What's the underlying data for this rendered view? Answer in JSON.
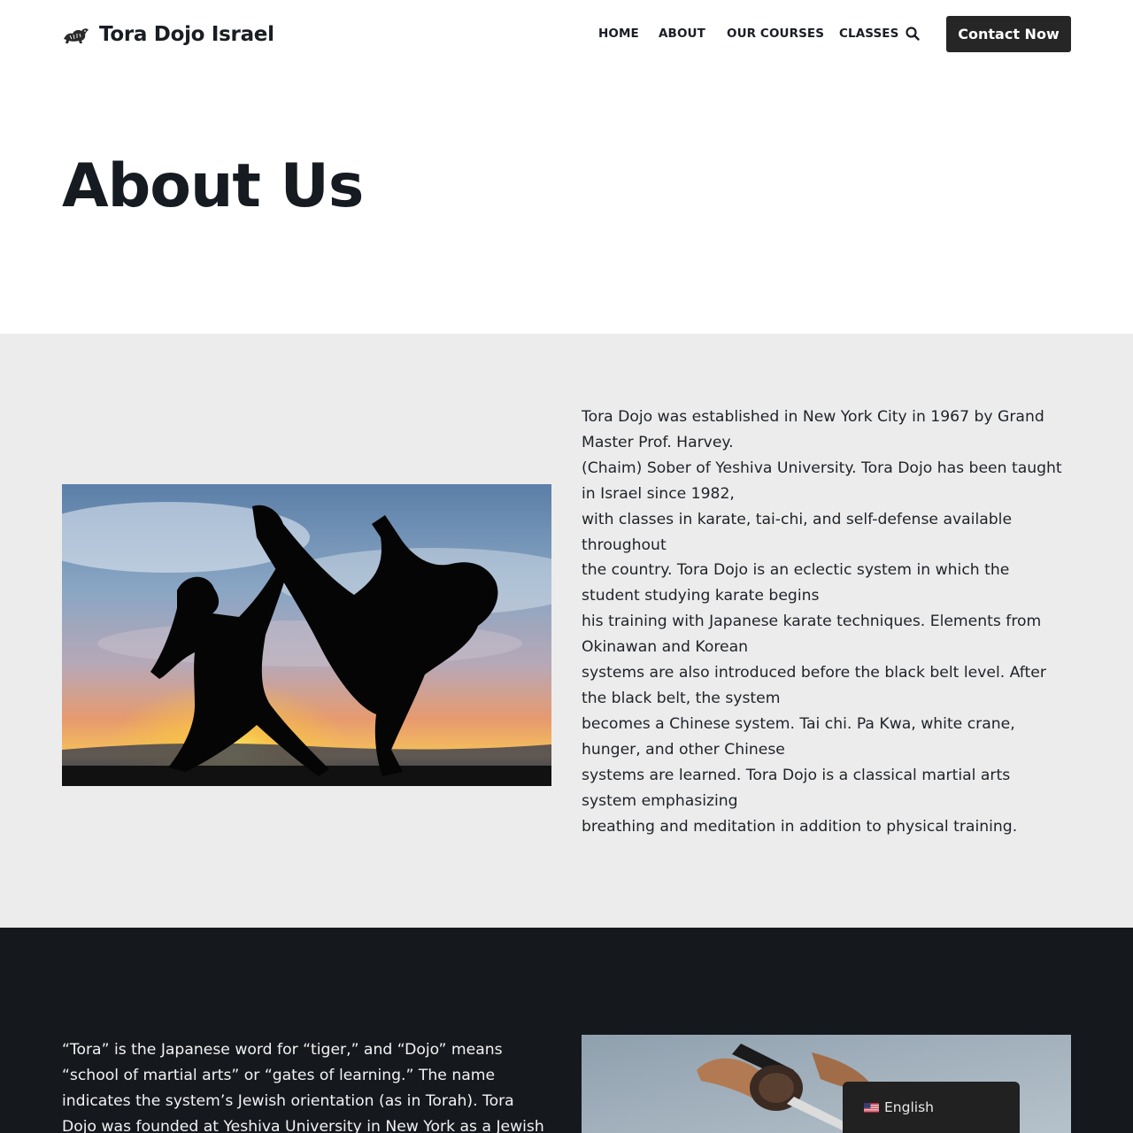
{
  "header": {
    "brand": "Tora Dojo Israel",
    "logo_icon": "tiger-logo-icon",
    "nav": [
      "HOME",
      "ABOUT",
      "OUR COURSES",
      "CLASSES"
    ],
    "search_icon": "search-icon",
    "cta": "Contact Now"
  },
  "title": "About Us",
  "about": {
    "image": "karate-fighters-silhouette-sunset",
    "lines": [
      "Tora Dojo was established in New York City in 1967 by Grand",
      "Master Prof. Harvey.",
      "(Chaim) Sober of Yeshiva University. Tora Dojo has been taught",
      "in Israel since 1982,",
      "with classes in karate, tai-chi, and self-defense available",
      "throughout",
      "the country. Tora Dojo is an eclectic system in which the",
      "student studying karate begins",
      "his training with Japanese karate techniques. Elements from",
      "Okinawan and Korean",
      "systems are also introduced before the black belt level. After",
      "the black belt, the system",
      "becomes a Chinese system. Tai chi. Pa Kwa, white crane,",
      "hunger, and other Chinese",
      "systems are learned. Tora Dojo is a classical martial arts",
      "system emphasizing",
      "breathing and meditation in addition to physical training."
    ]
  },
  "tora": {
    "lines": [
      "“Tora” is the Japanese word for “tiger,” and “Dojo” means",
      "“school of martial arts” or “gates of learning.” The name",
      "indicates the system’s Jewish orientation (as in Torah). Tora",
      "Dojo was founded at Yeshiva University in New York as a Jewish"
    ],
    "image": "sword-hands"
  },
  "language": {
    "label": "English",
    "flag_icon": "us-flag-icon"
  },
  "colors": {
    "text": "#1a1d23",
    "cta_bg": "#262626",
    "gray_section": "#ececec",
    "dark_section": "#15181d",
    "lang_bg": "#212121"
  }
}
